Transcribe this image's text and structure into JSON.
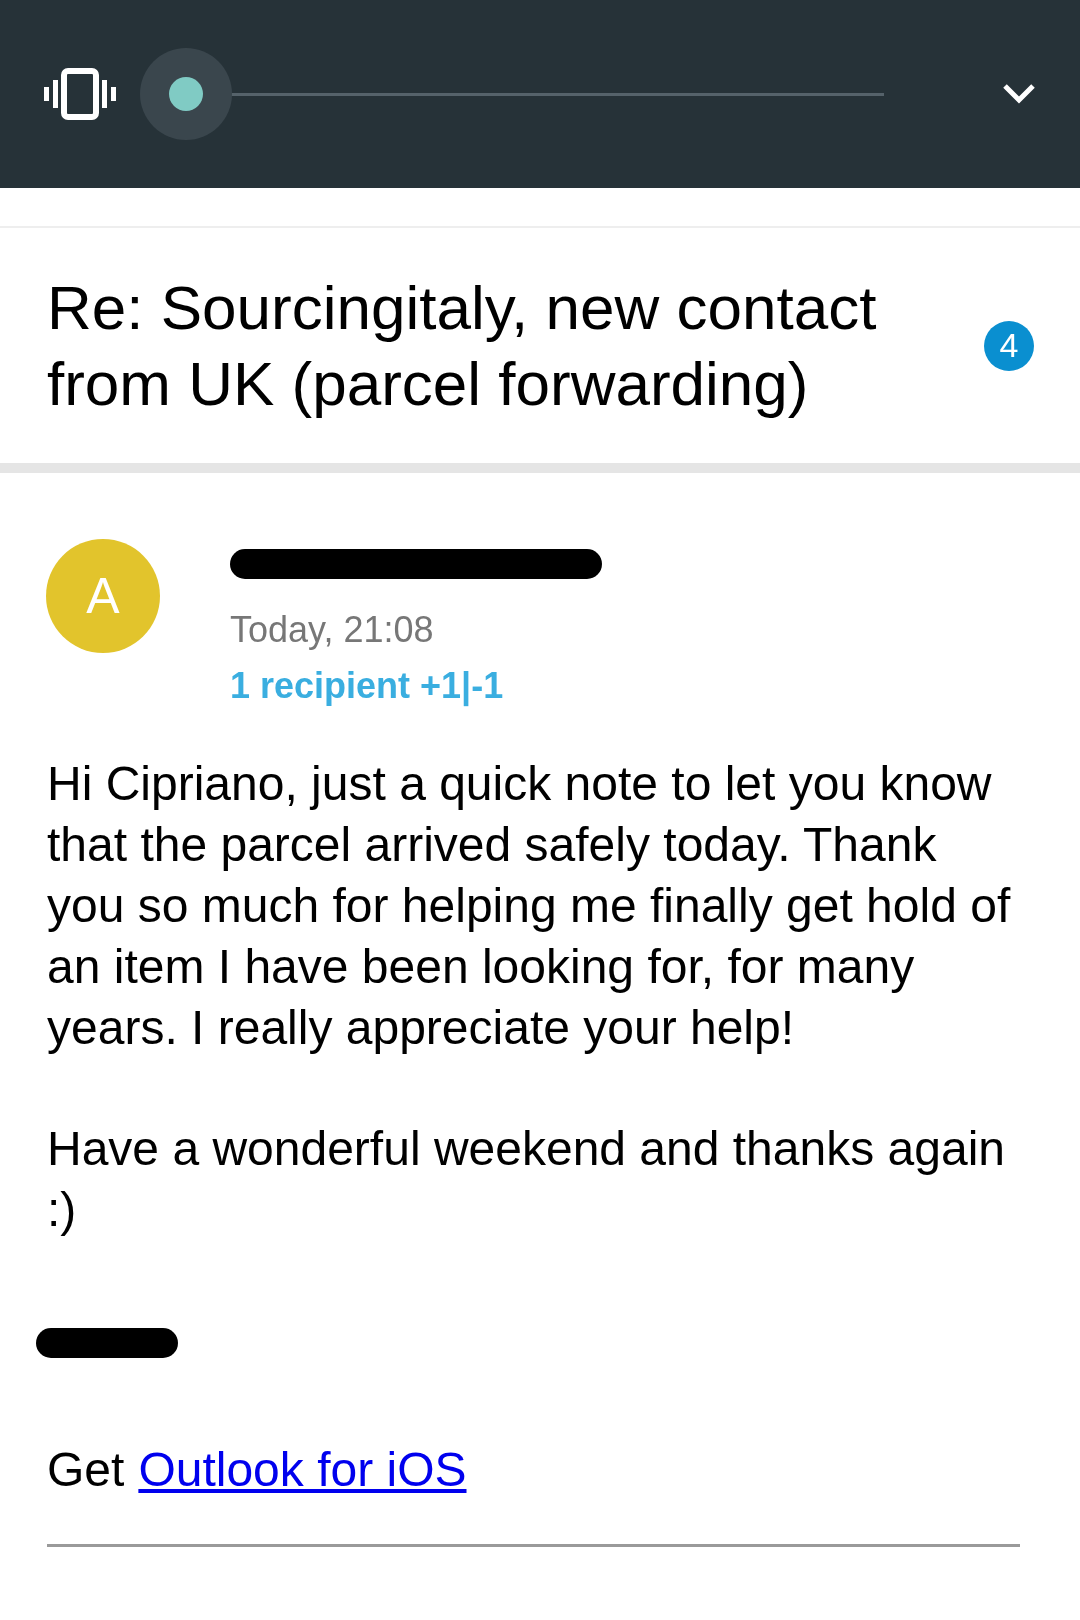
{
  "volume": {
    "level": 0
  },
  "subject": "Re: Sourcingitaly, new contact from UK (parcel forwarding)",
  "badge": "4",
  "sender": {
    "initial": "A",
    "name_redacted": true,
    "date": "Today, 21:08",
    "recipients": "1 recipient +1|-1"
  },
  "body": [
    "Hi Cipriano, just a quick note to let you know that the parcel arrived safely today. Thank you so much for helping me finally get hold of an item I have been looking for, for many years. I really appreciate your help!",
    "Have a wonderful weekend and thanks again :)"
  ],
  "signature_redacted": true,
  "footer": {
    "prefix": "Get",
    "link": "Outlook for iOS"
  }
}
